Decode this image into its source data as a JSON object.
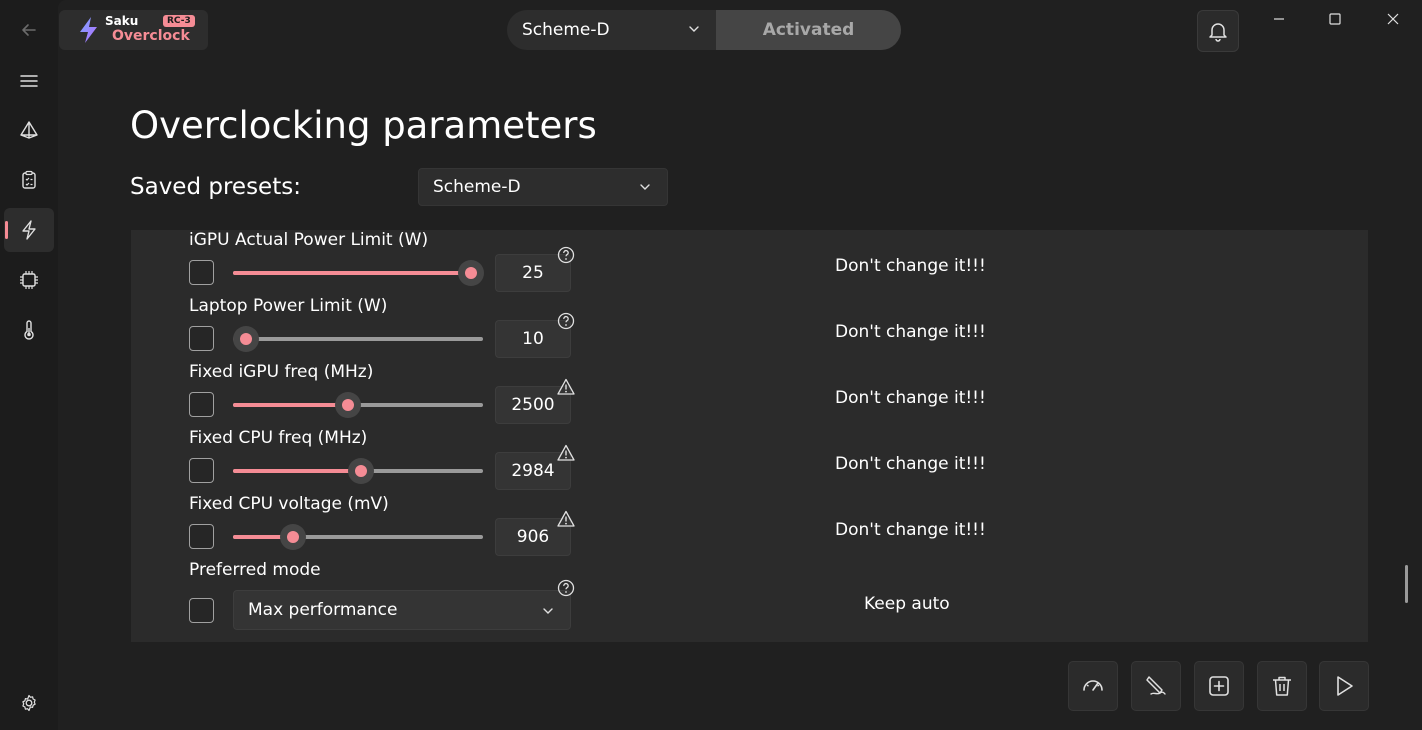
{
  "app": {
    "name": "Saku",
    "sub": "Overclock",
    "badge": "RC-3"
  },
  "header": {
    "scheme": "Scheme-D",
    "status": "Activated"
  },
  "page": {
    "title": "Overclocking parameters",
    "presets_label": "Saved presets:",
    "presets_value": "Scheme-D"
  },
  "rows": [
    {
      "label": "iGPU Actual Power Limit (W)",
      "value": "25",
      "note": "Don't change it!!!",
      "fill_fraction": 0.95,
      "hint": "question-icon"
    },
    {
      "label": "Laptop Power Limit (W)",
      "value": "10",
      "note": "Don't change it!!!",
      "fill_fraction": 0.05,
      "hint": "question-icon"
    },
    {
      "label": "Fixed iGPU freq (MHz)",
      "value": "2500",
      "note": "Don't change it!!!",
      "fill_fraction": 0.46,
      "hint": "warning-icon"
    },
    {
      "label": "Fixed CPU freq (MHz)",
      "value": "2984",
      "note": "Don't change it!!!",
      "fill_fraction": 0.51,
      "hint": "warning-icon"
    },
    {
      "label": "Fixed CPU voltage (mV)",
      "value": "906",
      "note": "Don't change it!!!",
      "fill_fraction": 0.24,
      "hint": "warning-icon"
    }
  ],
  "mode": {
    "label": "Preferred mode",
    "value": "Max performance",
    "note": "Keep auto"
  },
  "colors": {
    "accent": "#f58c95",
    "background": "#202020",
    "panel": "#2b2b2b"
  }
}
